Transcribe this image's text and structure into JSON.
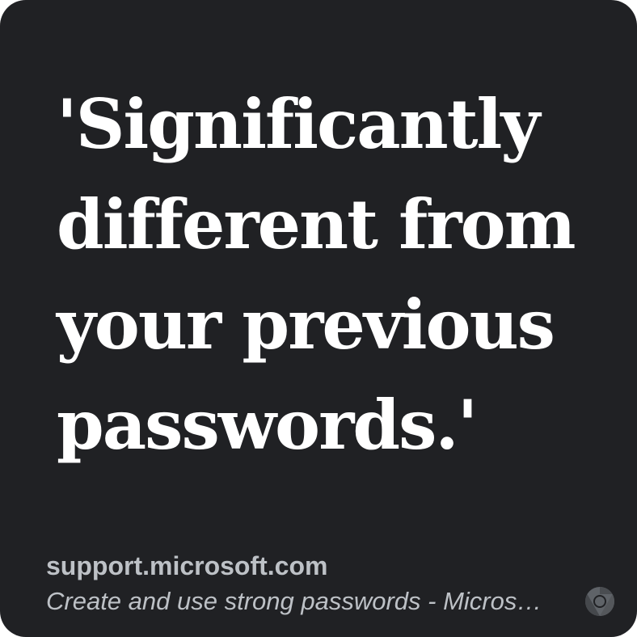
{
  "card": {
    "quote_lines": "'Significantly\ndifferent from\nyour previous\npasswords.'",
    "source": {
      "domain": "support.microsoft.com",
      "title": "Create and use strong passwords - Micros…"
    },
    "browser_icon": "chrome-icon"
  },
  "colors": {
    "background": "#202124",
    "quote_text": "#ffffff",
    "source_text": "#bdc1c6",
    "icon": "#5f6368"
  }
}
